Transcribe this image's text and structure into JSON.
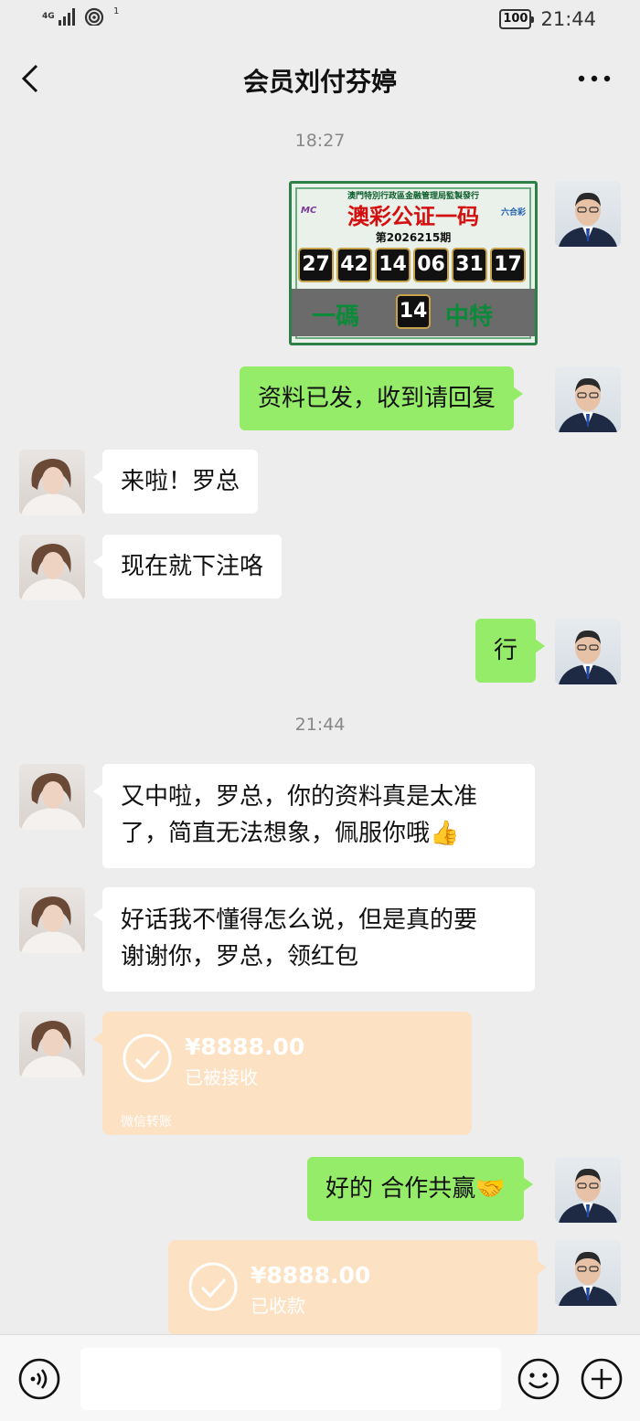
{
  "status_bar": {
    "network": "4G",
    "sim_badge": "1",
    "battery": "100",
    "time": "21:44"
  },
  "header": {
    "title": "会员刘付芬婷",
    "back_icon": "chevron-left-icon",
    "more_icon": "more-dots-icon"
  },
  "time_labels": [
    "18:27",
    "21:44"
  ],
  "lottery": {
    "header": "澳門特別行政區金融管理局監製發行",
    "title": "澳彩公证一码",
    "logo_left": "MC",
    "logo_right": "六合彩",
    "issue": "第2026215期",
    "numbers": [
      "27",
      "42",
      "14",
      "06",
      "31",
      "17"
    ],
    "bottom_left": "一碼",
    "special": "14",
    "bottom_right": "中特"
  },
  "messages": [
    {
      "side": "right",
      "text": "资料已发，收到请回复"
    },
    {
      "side": "left",
      "text": "来啦！罗总"
    },
    {
      "side": "left",
      "text": "现在就下注咯"
    },
    {
      "side": "right",
      "text": "行"
    },
    {
      "side": "left",
      "line1": "又中啦，罗总，你的资料真是太准",
      "line2": "了，简直无法想象，佩服你哦👍"
    },
    {
      "side": "left",
      "line1": "好话我不懂得怎么说，但是真的要",
      "line2": "谢谢你，罗总，领红包"
    },
    {
      "side": "right",
      "text": "好的 合作共赢🤝"
    }
  ],
  "transfers": [
    {
      "side": "left",
      "amount": "¥8888.00",
      "status": "已被接收",
      "footer": "微信转账"
    },
    {
      "side": "right",
      "amount": "¥8888.00",
      "status": "已收款"
    }
  ],
  "input_bar": {
    "voice_icon": "voice-icon",
    "emoji_icon": "emoji-icon",
    "plus_icon": "plus-icon",
    "input_value": ""
  },
  "colors": {
    "background": "#ededed",
    "bubble_self": "#95ec69",
    "bubble_other": "#ffffff",
    "transfer": "#fde1c3"
  }
}
